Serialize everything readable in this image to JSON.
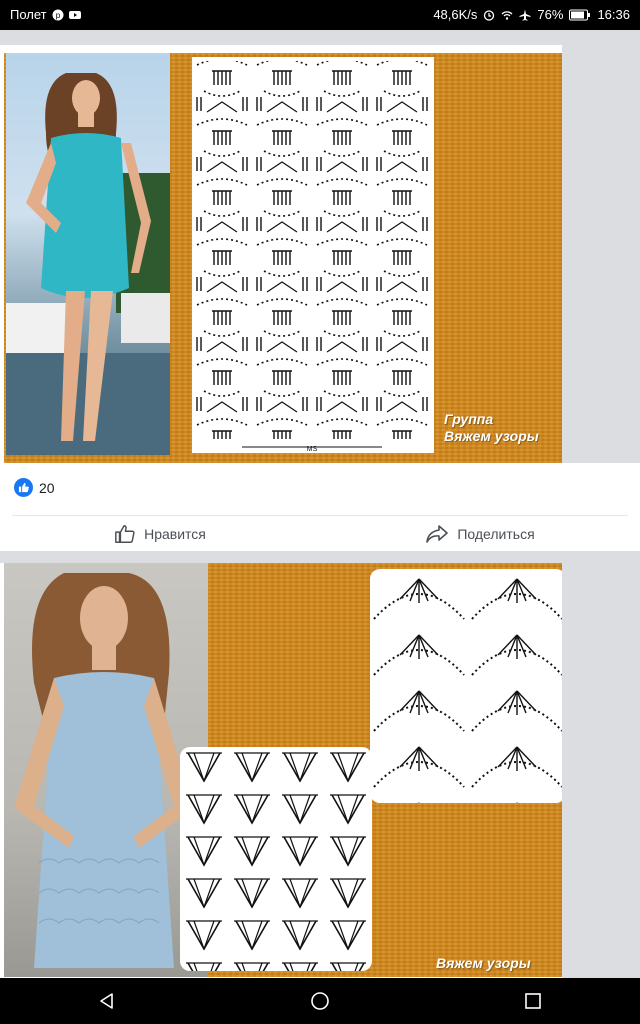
{
  "status_bar": {
    "carrier": "Полет",
    "net_speed": "48,6K/s",
    "battery": "76%",
    "time": "16:36"
  },
  "post1": {
    "watermark_line1": "Группа",
    "watermark_line2": "Вяжем узоры",
    "diagram_label": "MS",
    "reaction_count": "20",
    "like_label": "Нравится",
    "share_label": "Поделиться"
  },
  "post2": {
    "watermark": "Вяжем узоры"
  },
  "colors": {
    "accent": "#1877f2",
    "image_bg": "#d4891a"
  },
  "icons": {
    "like": "thumbs-up-icon",
    "share": "share-arrow-icon",
    "back": "back-icon",
    "home": "home-icon",
    "recents": "recents-icon"
  }
}
